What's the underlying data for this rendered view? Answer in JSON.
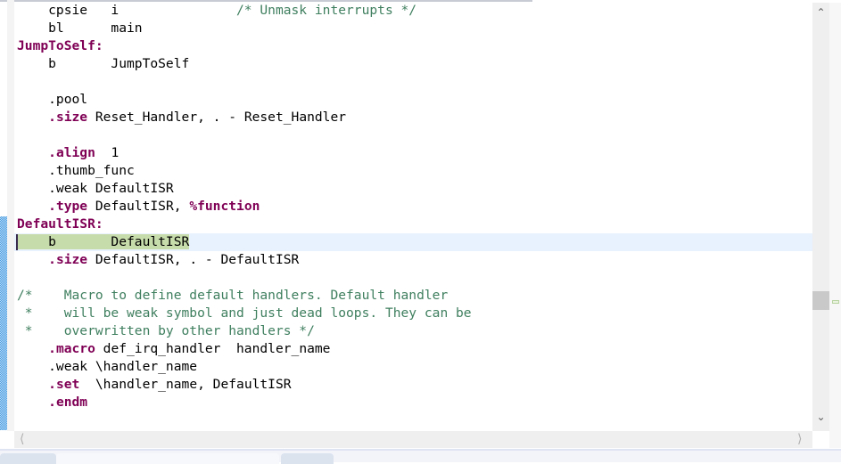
{
  "editor": {
    "lines": [
      [
        {
          "t": "    cpsie   i               "
        },
        {
          "t": "/* Unmask interrupts */",
          "c": "cm"
        }
      ],
      [
        {
          "t": "    bl      main"
        }
      ],
      [
        {
          "t": "JumpToSelf:",
          "c": "kw"
        }
      ],
      [
        {
          "t": "    b       JumpToSelf"
        }
      ],
      [],
      [
        {
          "t": "    .pool"
        }
      ],
      [
        {
          "t": "    "
        },
        {
          "t": ".size",
          "c": "kw"
        },
        {
          "t": " Reset_Handler, . - Reset_Handler"
        }
      ],
      [],
      [
        {
          "t": "    "
        },
        {
          "t": ".align",
          "c": "kw"
        },
        {
          "t": "  1"
        }
      ],
      [
        {
          "t": "    .thumb_func"
        }
      ],
      [
        {
          "t": "    .weak DefaultISR"
        }
      ],
      [
        {
          "t": "    "
        },
        {
          "t": ".type",
          "c": "kw"
        },
        {
          "t": " DefaultISR, "
        },
        {
          "t": "%function",
          "c": "kw"
        }
      ],
      [
        {
          "t": "DefaultISR:",
          "c": "kw"
        }
      ],
      [
        {
          "t": "    b       DefaultISR",
          "c": "hl"
        }
      ],
      [
        {
          "t": "    "
        },
        {
          "t": ".size",
          "c": "kw"
        },
        {
          "t": " DefaultISR, . - DefaultISR"
        }
      ],
      [],
      [
        {
          "t": "/*    Macro to define default handlers. Default handler",
          "c": "cm"
        }
      ],
      [
        {
          "t": " *    will be weak symbol and just dead loops. They can be",
          "c": "cm"
        }
      ],
      [
        {
          "t": " *    overwritten by other handlers */",
          "c": "cm"
        }
      ],
      [
        {
          "t": "    "
        },
        {
          "t": ".macro",
          "c": "kw"
        },
        {
          "t": " def_irq_handler  handler_name"
        }
      ],
      [
        {
          "t": "    .weak \\handler_name"
        }
      ],
      [
        {
          "t": "    "
        },
        {
          "t": ".set",
          "c": "kw"
        },
        {
          "t": "  \\handler_name, DefaultISR"
        }
      ],
      [
        {
          "t": "    "
        },
        {
          "t": ".endm",
          "c": "kw"
        }
      ]
    ],
    "current_line_index": 13
  },
  "icons": {
    "scroll_up": "▲",
    "scroll_down": "▼",
    "scroll_left": "‹",
    "scroll_right": "›"
  },
  "colors": {
    "keyword": "#7f0055",
    "comment": "#3f7f5f",
    "current_line": "#e8f2fe",
    "selection": "#c7dcab"
  }
}
